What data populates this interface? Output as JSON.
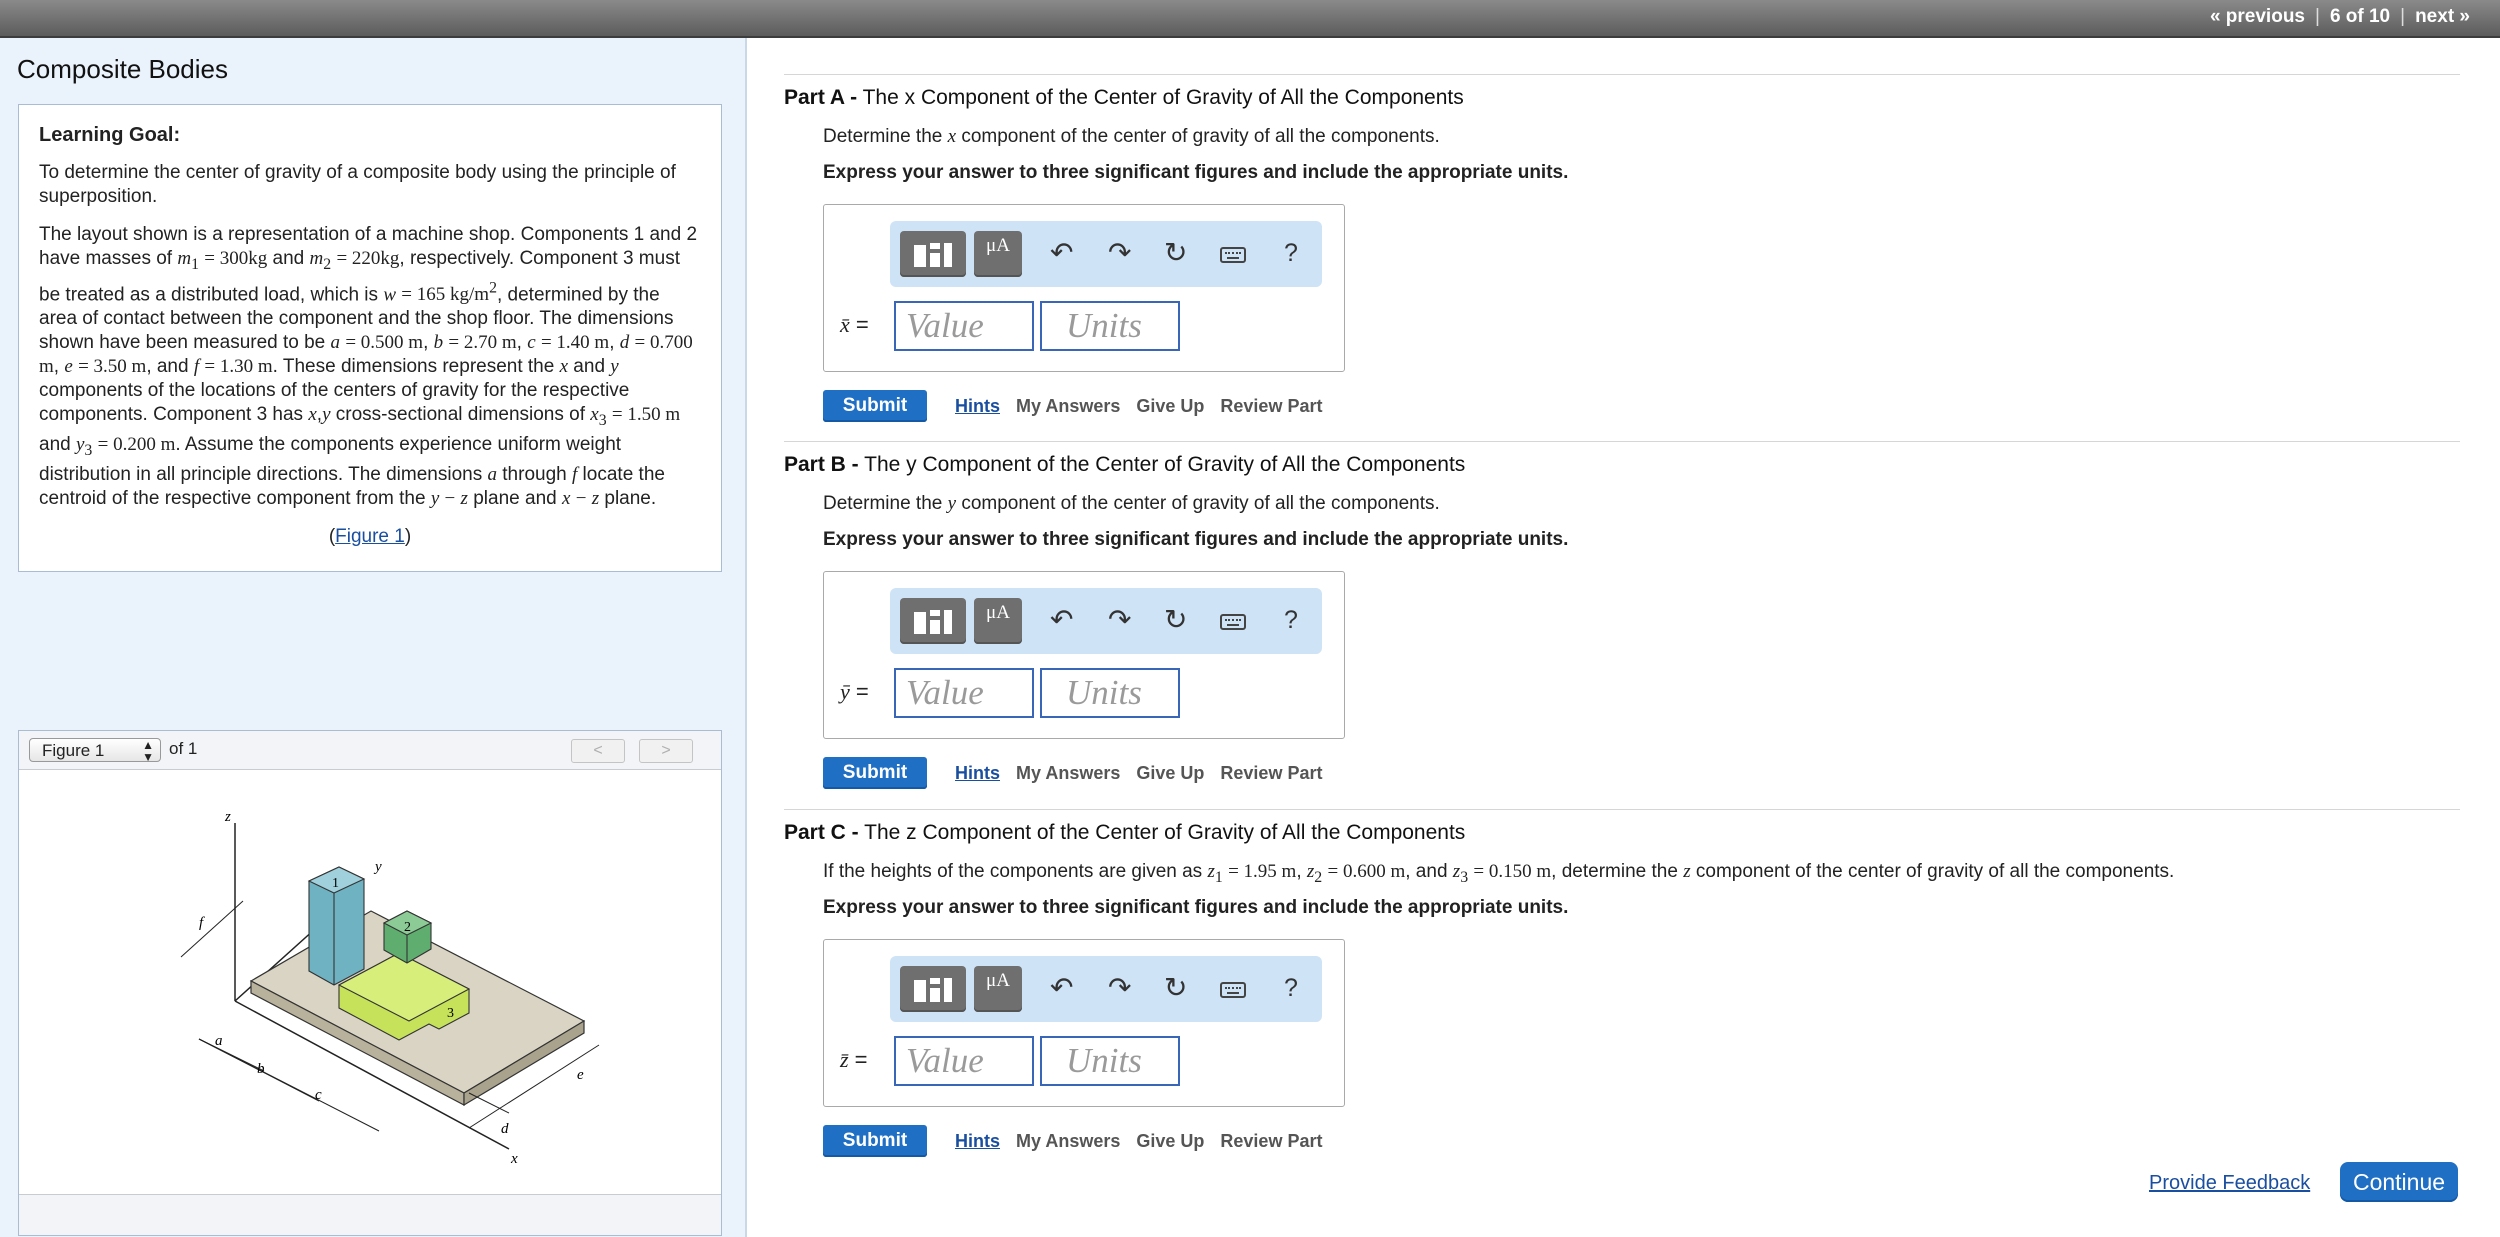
{
  "nav": {
    "previous": "« previous",
    "position": "6 of 10",
    "next": "next »"
  },
  "page_title": "Composite Bodies",
  "goal": {
    "label": "Learning Goal:",
    "text": "To determine the center of gravity of a composite body using the principle of superposition.",
    "figure_link": "Figure 1"
  },
  "figure": {
    "select_value": "Figure 1",
    "of_text": "of 1",
    "labels": {
      "z": "z",
      "y": "y",
      "x": "x",
      "f": "f",
      "a": "a",
      "b": "b",
      "c": "c",
      "d": "d",
      "e": "e",
      "c1": "1",
      "c2": "2",
      "c3": "3"
    }
  },
  "parts": [
    {
      "letter": "Part A -",
      "title": "The x Component of the Center of Gravity of All the Components",
      "instruction": "Express your answer to three significant figures and include the appropriate units.",
      "value_placeholder": "Value",
      "units_placeholder": "Units",
      "submit": "Submit",
      "hints": "Hints",
      "my_answers": "My Answers",
      "give_up": "Give Up",
      "review": "Review Part",
      "mu": "μA"
    },
    {
      "letter": "Part B -",
      "title": "The y Component of the Center of Gravity of All the Components",
      "instruction": "Express your answer to three significant figures and include the appropriate units.",
      "value_placeholder": "Value",
      "units_placeholder": "Units",
      "submit": "Submit",
      "hints": "Hints",
      "my_answers": "My Answers",
      "give_up": "Give Up",
      "review": "Review Part",
      "mu": "μA"
    },
    {
      "letter": "Part C -",
      "title": "The z Component of the Center of Gravity of All the Components",
      "instruction": "Express your answer to three significant figures and include the appropriate units.",
      "value_placeholder": "Value",
      "units_placeholder": "Units",
      "submit": "Submit",
      "hints": "Hints",
      "my_answers": "My Answers",
      "give_up": "Give Up",
      "review": "Review Part",
      "mu": "μA"
    }
  ],
  "footer": {
    "feedback": "Provide Feedback",
    "continue": "Continue"
  },
  "colors": {
    "accent": "#1f6fc5",
    "link": "#1a4fa0",
    "panel": "#eaf2fb",
    "toolbar": "#cfe3f7"
  }
}
